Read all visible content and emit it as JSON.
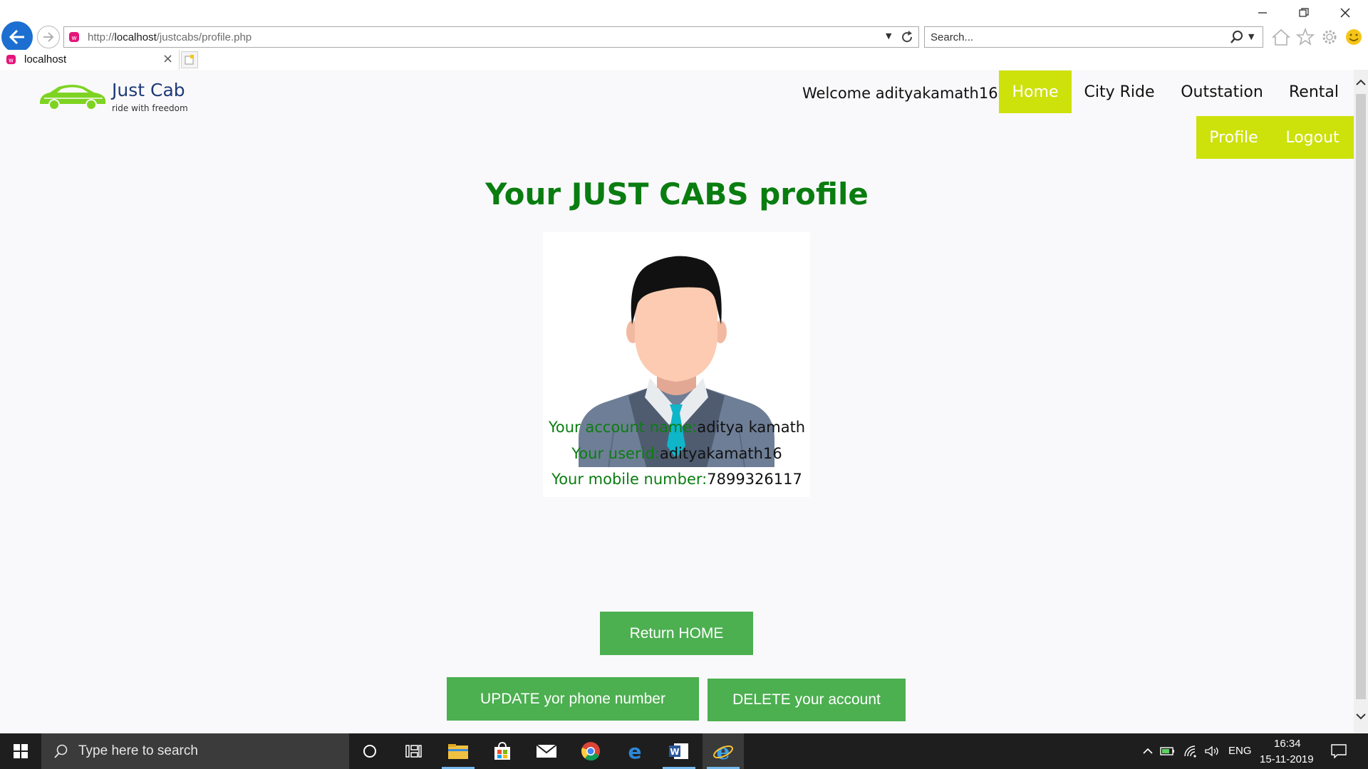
{
  "browser": {
    "address_prefix": "http://",
    "address_host": "localhost",
    "address_path": "/justcabs/profile.php",
    "search_placeholder": "Search...",
    "tab_title": "localhost"
  },
  "site": {
    "logo_name": "Just Cab",
    "logo_tagline": "ride with freedom",
    "welcome": "Welcome adityakamath16 .",
    "nav": [
      "Home",
      "City Ride",
      "Outstation",
      "Rental"
    ],
    "nav_secondary": [
      "Profile",
      "Logout"
    ],
    "active_nav": "Home",
    "accent_color": "#cde10b"
  },
  "profile": {
    "title": "Your JUST CABS profile",
    "account_name_label": "Your account name:",
    "account_name": "aditya kamath",
    "userid_label": "Your userid:",
    "userid": "adityakamath16",
    "mobile_label": "Your mobile number:",
    "mobile": "7899326117",
    "return_button": "Return HOME",
    "update_button": "UPDATE yor phone number",
    "delete_button": "DELETE your account",
    "title_color": "#0a7d10",
    "button_color": "#4caf50"
  },
  "taskbar": {
    "search_placeholder": "Type here to search",
    "language": "ENG",
    "time": "16:34",
    "date": "15-11-2019"
  }
}
